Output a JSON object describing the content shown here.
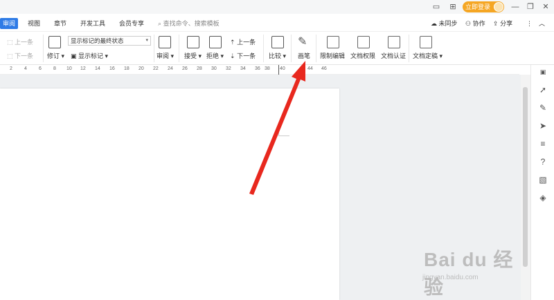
{
  "topbar": {
    "login_label": "立即登录",
    "icons": [
      "view-mode-icon",
      "grid-apps-icon",
      "minimize-icon",
      "restore-icon",
      "close-icon"
    ]
  },
  "tabs": {
    "items": [
      "审阅",
      "视图",
      "章节",
      "开发工具",
      "会员专享"
    ],
    "active": "审阅",
    "search_placeholder": "查找命令、搜索模板",
    "right": {
      "sync": "未同步",
      "collab": "协作",
      "share": "分享"
    }
  },
  "ribbon": {
    "prev_change": "上一条",
    "next_change": "下一条",
    "revise": "修订",
    "display_state": "显示标记的最终状态",
    "show_markup": "显示标记",
    "review": "审阅",
    "accept": "接受",
    "reject": "拒绝",
    "prev": "上一条",
    "next": "下一条",
    "compare": "比较",
    "pen": "画笔",
    "restrict_edit": "限制编辑",
    "doc_permission": "文档权限",
    "doc_cert": "文档认证",
    "doc_finalize": "文档定稿"
  },
  "ruler": {
    "ticks": [
      "2",
      "4",
      "6",
      "8",
      "10",
      "12",
      "14",
      "16",
      "18",
      "20",
      "22",
      "24",
      "26",
      "28",
      "30",
      "32",
      "34",
      "36",
      "38",
      "40",
      "44",
      "46"
    ]
  },
  "side_panel": {
    "icons": [
      "rocket-icon",
      "pen-icon",
      "cursor-select-icon",
      "adjust-sliders-icon",
      "help-icon",
      "image-tool-icon",
      "compass-icon"
    ]
  },
  "watermark": {
    "brand": "Bai du 经验",
    "url": "jingyan.baidu.com"
  },
  "colors": {
    "accent": "#2e7be6",
    "login": "#f5a623",
    "arrow": "#e8281e"
  }
}
